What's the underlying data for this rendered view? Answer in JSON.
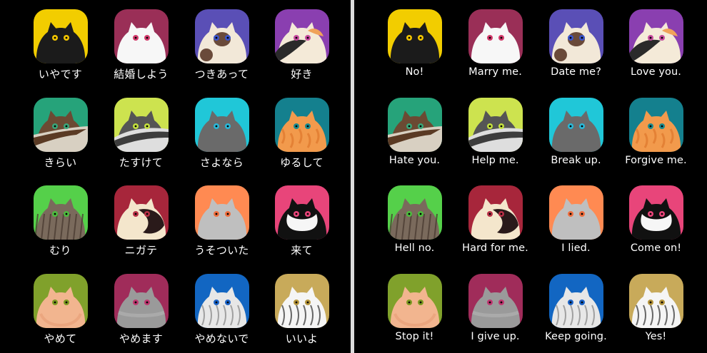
{
  "panels": {
    "left": {
      "apps": [
        {
          "label": "いやです",
          "icon": "cat-icon-black",
          "colors": {
            "bg": "#f2cd00",
            "body": "#1b1b1b",
            "eye": "#f2c500"
          }
        },
        {
          "label": "結婚しよう",
          "icon": "cat-icon-white",
          "colors": {
            "bg": "#9a2f57",
            "body": "#f7f7f7",
            "eye": "#d23a6b"
          }
        },
        {
          "label": "つきあって",
          "icon": "cat-icon-siamese",
          "colors": {
            "bg": "#5a4fb6",
            "body": "#f2e8d8",
            "eye": "#3b54c9"
          }
        },
        {
          "label": "好き",
          "icon": "cat-icon-calico",
          "colors": {
            "bg": "#8a3fb0",
            "body": "#f4ead8",
            "eye": "#c64b9e"
          }
        },
        {
          "label": "きらい",
          "icon": "cat-icon-brown-tabby",
          "colors": {
            "bg": "#26a37a",
            "body": "#6b4a33",
            "eye": "#3aa679"
          }
        },
        {
          "label": "たすけて",
          "icon": "cat-icon-gray-white",
          "colors": {
            "bg": "#cde34f",
            "body": "#555",
            "eye": "#c3df3e"
          }
        },
        {
          "label": "さよなら",
          "icon": "cat-icon-gray",
          "colors": {
            "bg": "#20c7d8",
            "body": "#6a6a6a",
            "eye": "#29b8d8"
          }
        },
        {
          "label": "ゆるして",
          "icon": "cat-icon-orange-tabby",
          "colors": {
            "bg": "#14808e",
            "body": "#f29a4c",
            "eye": "#1b8a8e"
          }
        },
        {
          "label": "むり",
          "icon": "cat-icon-striped",
          "colors": {
            "bg": "#55d04a",
            "body": "#7a6a5c",
            "eye": "#4bbd3d"
          }
        },
        {
          "label": "ニガテ",
          "icon": "cat-icon-cream-black",
          "colors": {
            "bg": "#a7263b",
            "body": "#f4e6cc",
            "eye": "#b83046"
          }
        },
        {
          "label": "うそついた",
          "icon": "cat-icon-silver",
          "colors": {
            "bg": "#ff8a52",
            "body": "#bfbfbf",
            "eye": "#ef6d3d"
          }
        },
        {
          "label": "来て",
          "icon": "cat-icon-tuxedo",
          "colors": {
            "bg": "#e8457a",
            "body": "#111",
            "eye": "#e8457a"
          }
        },
        {
          "label": "やめて",
          "icon": "cat-icon-fluffy-peach",
          "colors": {
            "bg": "#80a12b",
            "body": "#f2b58f",
            "eye": "#7c9a22"
          }
        },
        {
          "label": "やめます",
          "icon": "cat-icon-fluffy-gray",
          "colors": {
            "bg": "#a02c5a",
            "body": "#9a9a9a",
            "eye": "#bf3670"
          }
        },
        {
          "label": "やめないで",
          "icon": "cat-icon-silver-tabby",
          "colors": {
            "bg": "#1266c2",
            "body": "#e7e7e7",
            "eye": "#1b63c7"
          }
        },
        {
          "label": "いいよ",
          "icon": "cat-icon-white-striped",
          "colors": {
            "bg": "#c8aa5a",
            "body": "#f5f5f5",
            "eye": "#b6953c"
          }
        }
      ]
    },
    "right": {
      "apps": [
        {
          "label": "No!",
          "icon": "cat-icon-black",
          "colors": {
            "bg": "#f2cd00",
            "body": "#1b1b1b",
            "eye": "#f2c500"
          }
        },
        {
          "label": "Marry me.",
          "icon": "cat-icon-white",
          "colors": {
            "bg": "#9a2f57",
            "body": "#f7f7f7",
            "eye": "#d23a6b"
          }
        },
        {
          "label": "Date me?",
          "icon": "cat-icon-siamese",
          "colors": {
            "bg": "#5a4fb6",
            "body": "#f2e8d8",
            "eye": "#3b54c9"
          }
        },
        {
          "label": "Love you.",
          "icon": "cat-icon-calico",
          "colors": {
            "bg": "#8a3fb0",
            "body": "#f4ead8",
            "eye": "#c64b9e"
          }
        },
        {
          "label": "Hate you.",
          "icon": "cat-icon-brown-tabby",
          "colors": {
            "bg": "#26a37a",
            "body": "#6b4a33",
            "eye": "#3aa679"
          }
        },
        {
          "label": "Help me.",
          "icon": "cat-icon-gray-white",
          "colors": {
            "bg": "#cde34f",
            "body": "#555",
            "eye": "#c3df3e"
          }
        },
        {
          "label": "Break up.",
          "icon": "cat-icon-gray",
          "colors": {
            "bg": "#20c7d8",
            "body": "#6a6a6a",
            "eye": "#29b8d8"
          }
        },
        {
          "label": "Forgive me.",
          "icon": "cat-icon-orange-tabby",
          "colors": {
            "bg": "#14808e",
            "body": "#f29a4c",
            "eye": "#1b8a8e"
          }
        },
        {
          "label": "Hell no.",
          "icon": "cat-icon-striped",
          "colors": {
            "bg": "#55d04a",
            "body": "#7a6a5c",
            "eye": "#4bbd3d"
          }
        },
        {
          "label": "Hard for me.",
          "icon": "cat-icon-cream-black",
          "colors": {
            "bg": "#a7263b",
            "body": "#f4e6cc",
            "eye": "#b83046"
          }
        },
        {
          "label": "I lied.",
          "icon": "cat-icon-silver",
          "colors": {
            "bg": "#ff8a52",
            "body": "#bfbfbf",
            "eye": "#ef6d3d"
          }
        },
        {
          "label": "Come on!",
          "icon": "cat-icon-tuxedo",
          "colors": {
            "bg": "#e8457a",
            "body": "#111",
            "eye": "#e8457a"
          }
        },
        {
          "label": "Stop it!",
          "icon": "cat-icon-fluffy-peach",
          "colors": {
            "bg": "#80a12b",
            "body": "#f2b58f",
            "eye": "#7c9a22"
          }
        },
        {
          "label": "I give up.",
          "icon": "cat-icon-fluffy-gray",
          "colors": {
            "bg": "#a02c5a",
            "body": "#9a9a9a",
            "eye": "#bf3670"
          }
        },
        {
          "label": "Keep going.",
          "icon": "cat-icon-silver-tabby",
          "colors": {
            "bg": "#1266c2",
            "body": "#e7e7e7",
            "eye": "#1b63c7"
          }
        },
        {
          "label": "Yes!",
          "icon": "cat-icon-white-striped",
          "colors": {
            "bg": "#c8aa5a",
            "body": "#f5f5f5",
            "eye": "#b6953c"
          }
        }
      ]
    }
  }
}
